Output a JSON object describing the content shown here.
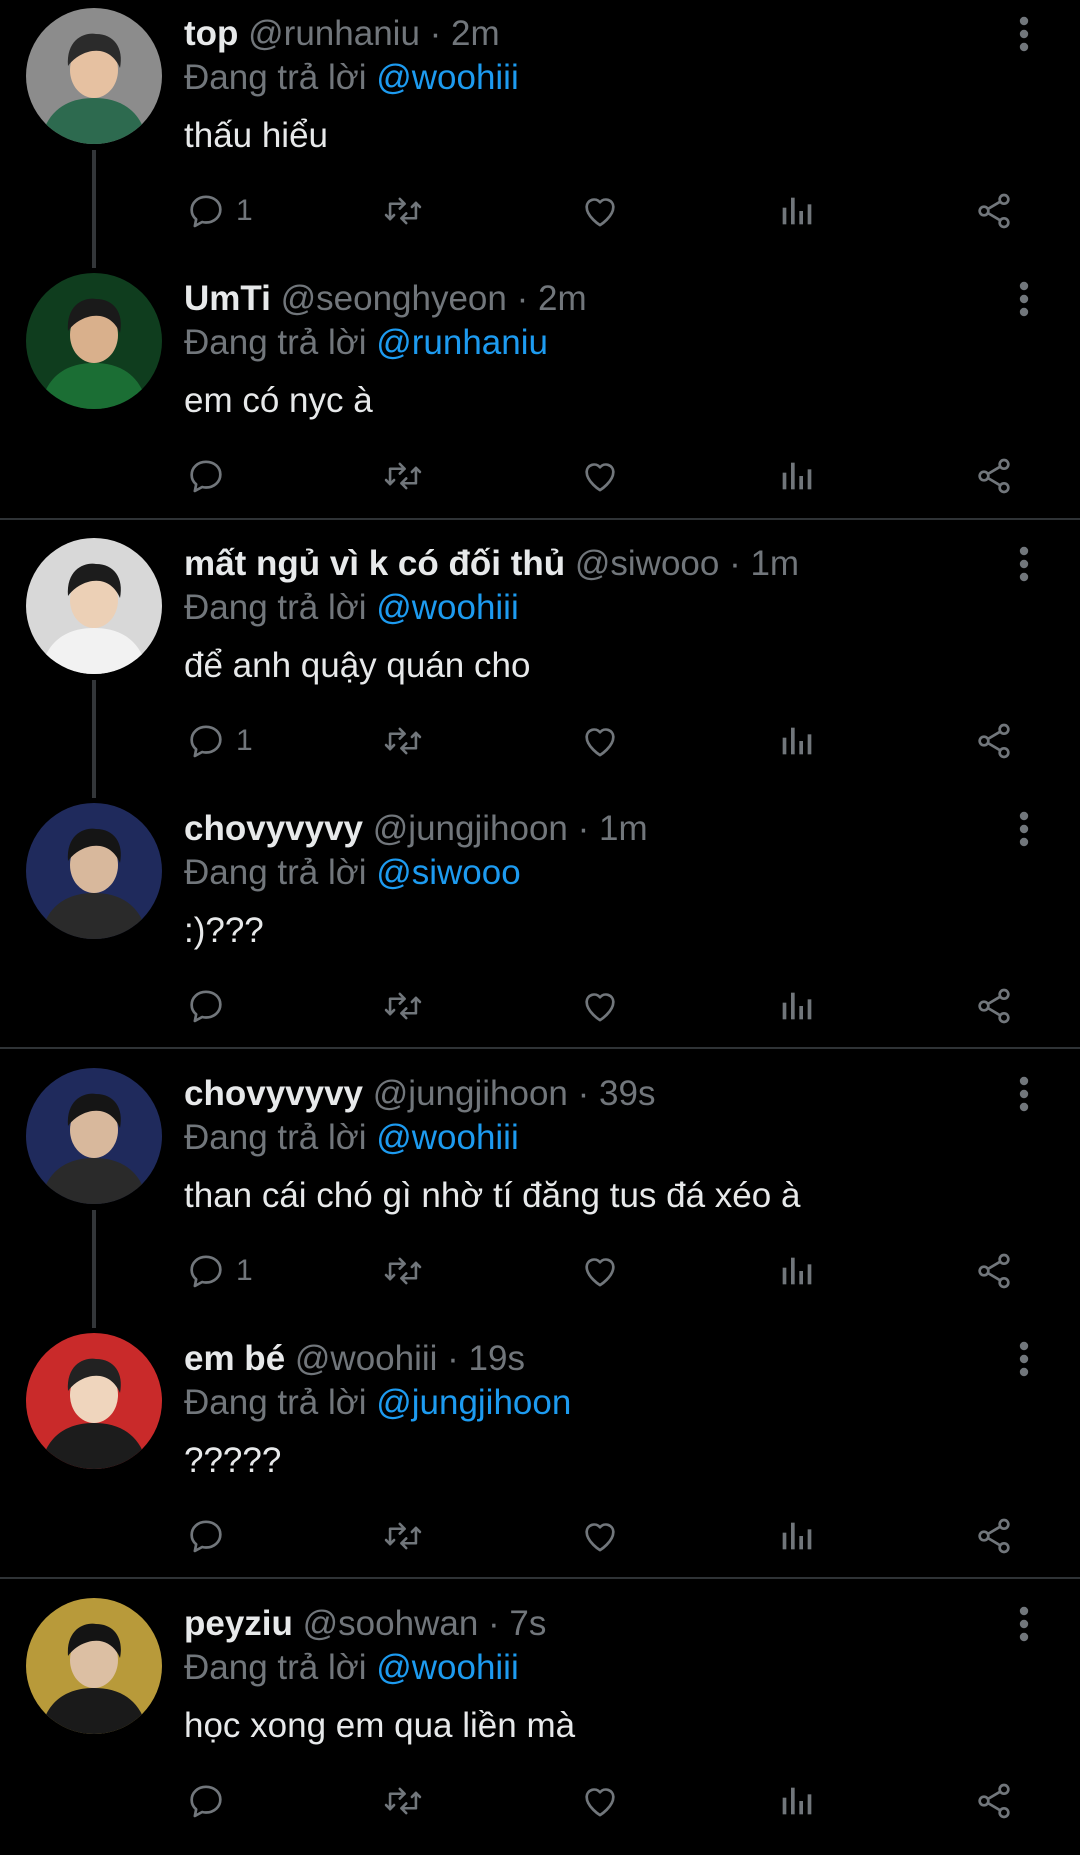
{
  "tweets": [
    {
      "name": "top",
      "handle": "@runhaniu",
      "time": "2m",
      "reply_prefix": "Đang trả lời",
      "reply_to": "@woohiii",
      "text": "thấu hiểu",
      "reply_count": "1",
      "avatar_colors": {
        "bg": "#8c8c8c",
        "shirt": "#2d6a4f",
        "hair": "#2b2b2b",
        "skin": "#e6c1a1"
      }
    },
    {
      "name": "UmTi",
      "handle": "@seonghyeon",
      "time": "2m",
      "reply_prefix": "Đang trả lời",
      "reply_to": "@runhaniu",
      "text": "em có nyc à",
      "reply_count": "",
      "avatar_colors": {
        "bg": "#0f3d1e",
        "shirt": "#1b6e34",
        "hair": "#1a1a1a",
        "skin": "#d9b08c"
      }
    },
    {
      "name": "mất ngủ vì k có đối thủ",
      "handle": "@siwooo",
      "time": "1m",
      "reply_prefix": "Đang trả lời",
      "reply_to": "@woohiii",
      "text": "để anh quậy quán cho",
      "reply_count": "1",
      "avatar_colors": {
        "bg": "#d8d8d8",
        "shirt": "#f2f2f2",
        "hair": "#1c1c1c",
        "skin": "#ecd0b6"
      }
    },
    {
      "name": "chovyvyvy",
      "handle": "@jungjihoon",
      "time": "1m",
      "reply_prefix": "Đang trả lời",
      "reply_to": "@siwooo",
      "text": ":)???",
      "reply_count": "",
      "avatar_colors": {
        "bg": "#1f2a5c",
        "shirt": "#2a2a2a",
        "hair": "#151515",
        "skin": "#d8b89c"
      }
    },
    {
      "name": "chovyvyvy",
      "handle": "@jungjihoon",
      "time": "39s",
      "reply_prefix": "Đang trả lời",
      "reply_to": "@woohiii",
      "text": "than cái chó gì nhờ tí đăng tus đá xéo à",
      "reply_count": "1",
      "avatar_colors": {
        "bg": "#1f2a5c",
        "shirt": "#2a2a2a",
        "hair": "#151515",
        "skin": "#d8b89c"
      }
    },
    {
      "name": "em bé",
      "handle": "@woohiii",
      "time": "19s",
      "reply_prefix": "Đang trả lời",
      "reply_to": "@jungjihoon",
      "text": "?????",
      "reply_count": "",
      "avatar_colors": {
        "bg": "#c92a2a",
        "shirt": "#1c1c1c",
        "hair": "#222222",
        "skin": "#efd5bd"
      }
    },
    {
      "name": "peyziu",
      "handle": "@soohwan",
      "time": "7s",
      "reply_prefix": "Đang trả lời",
      "reply_to": "@woohiii",
      "text": "học xong em qua liền mà",
      "reply_count": "",
      "avatar_colors": {
        "bg": "#b89a3a",
        "shirt": "#1a1a1a",
        "hair": "#141414",
        "skin": "#dcbfa3"
      }
    }
  ],
  "separator": "·",
  "colors": {
    "background": "#000000",
    "text": "#e7e9ea",
    "muted": "#71767b",
    "link": "#1d9bf0",
    "divider": "#2f3336"
  },
  "icons": [
    "more-vertical-icon",
    "reply-icon",
    "retweet-icon",
    "like-icon",
    "views-icon",
    "share-icon"
  ]
}
